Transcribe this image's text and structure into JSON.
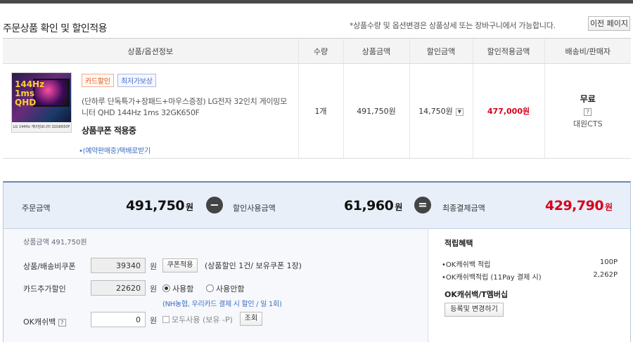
{
  "section_title": "주문상품 확인 및 할인적용",
  "notice": "*상품수량 및 옵션변경은 상품상세 또는 장바구니에서 가능합니다.",
  "prev_page_label": "이전 페이지",
  "table": {
    "headers": [
      "상품/옵션정보",
      "수량",
      "상품금액",
      "할인금액",
      "할인적용금액",
      "배송비/판매자"
    ],
    "item": {
      "badges": [
        "카드할인",
        "최저가보상"
      ],
      "name": "(단하루 단독특가+장패드+마우스증정) LG전자 32인치 게이밍모니터 QHD 144Hz 1ms 32GK650F",
      "coupon_status": "상품쿠폰 적용중",
      "reserve_link": "•(예약판매중)택배로받기",
      "thumb_text": "144Hz\n1ms\nQHD",
      "thumb_caption": "LG 144Hz 게이밍모니터 32GK650F",
      "quantity": "1개",
      "price": "491,750원",
      "discount": "14,750원",
      "discount_toggle": "▼",
      "final_price": "477,000원",
      "shipping": "무료",
      "shipping_help": "?",
      "seller": "대원CTS"
    }
  },
  "summary": {
    "order_label": "주문금액",
    "order_value": "491,750",
    "minus": "−",
    "discount_label": "할인사용금액",
    "discount_value": "61,960",
    "equals": "=",
    "final_label": "최종결제금액",
    "final_value": "429,790",
    "unit": "원"
  },
  "discount_panel": {
    "product_amount": "상품금액 491,750원",
    "coupon_label": "상품/배송비쿠폰",
    "coupon_value": "39340",
    "won": "원",
    "coupon_button": "쿠폰적용",
    "coupon_info": "(상품할인 1건/ 보유쿠폰 1장)",
    "card_label": "카드추가할인",
    "card_value": "22620",
    "use": "사용함",
    "not_use": "사용안함",
    "card_note": "(NH농협, 우리카드 결제 시 할인 / 일 1회)",
    "okcash_label": "OK캐쉬백",
    "okcash_help": "?",
    "okcash_value": "0",
    "use_all": "모두사용 (보유 -P)",
    "query_button": "조회"
  },
  "benefit_panel": {
    "title": "적립혜택",
    "rows": [
      {
        "label": "•OK캐쉬백 적립",
        "value": "100P"
      },
      {
        "label": "•OK캐쉬백적립 (11Pay 결제 시)",
        "value": "2,262P"
      }
    ],
    "sub_title": "OK캐쉬백/T멤버십",
    "register_button": "등록및 변경하기"
  }
}
